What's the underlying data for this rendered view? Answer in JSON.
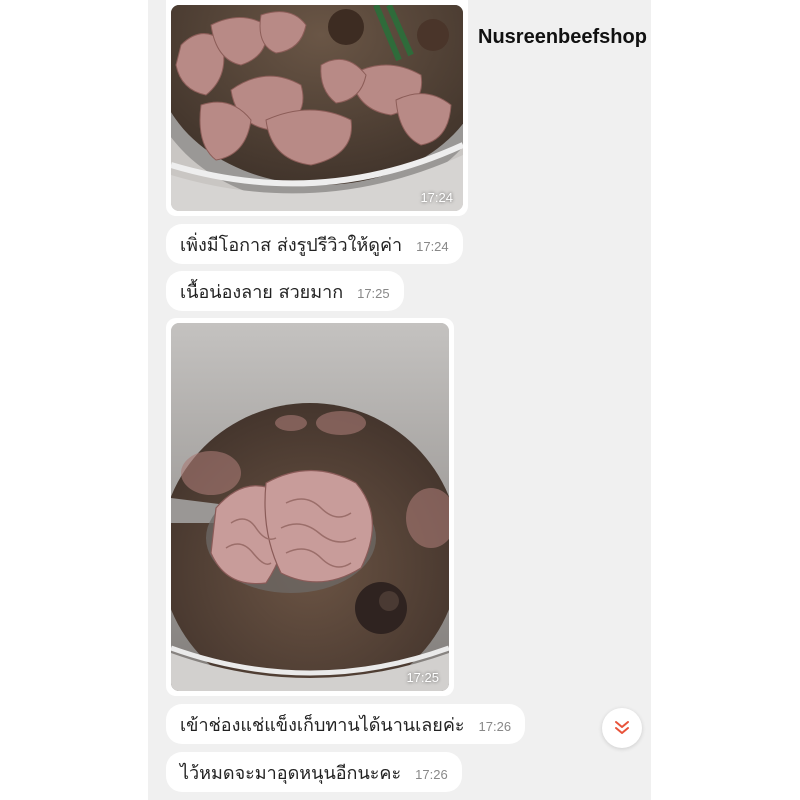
{
  "header": {
    "shop_name": "Nusreenbeefshop"
  },
  "messages": [
    {
      "type": "image",
      "time": "17:24",
      "icon": "beef-tripe-soup-photo"
    },
    {
      "type": "text",
      "text": "เพิ่งมีโอกาส ส่งรูปรีวิวให้ดูค่า",
      "time": "17:24"
    },
    {
      "type": "text",
      "text": "เนื้อน่องลาย สวยมาก",
      "time": "17:25"
    },
    {
      "type": "image",
      "time": "17:25",
      "icon": "beef-on-ladle-photo"
    },
    {
      "type": "text",
      "text": "เข้าช่องแช่แข็งเก็บทานได้นานเลยค่ะ",
      "time": "17:26"
    },
    {
      "type": "text",
      "text": "ไว้หมดจะมาอุดหนุนอีกนะคะ",
      "time": "17:26"
    }
  ],
  "scroll_button": {
    "icon": "double-chevron-down-icon",
    "color": "#e8533a"
  },
  "colors": {
    "chat_bg": "#f0f0f0",
    "bubble_bg": "#ffffff",
    "time_color": "#888888"
  }
}
